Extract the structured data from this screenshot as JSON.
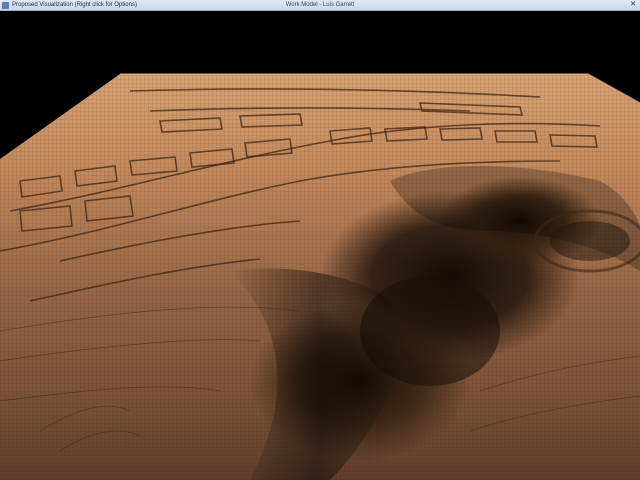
{
  "window": {
    "left_title": "Proposed Visualization (Right click for Options)",
    "center_title": "Work Model - Luis Garrett",
    "close_glyph": "✕"
  },
  "viewport": {
    "background_color": "#000000",
    "terrain_color": "#b87c4e",
    "shadow_color": "#2a1a10"
  }
}
